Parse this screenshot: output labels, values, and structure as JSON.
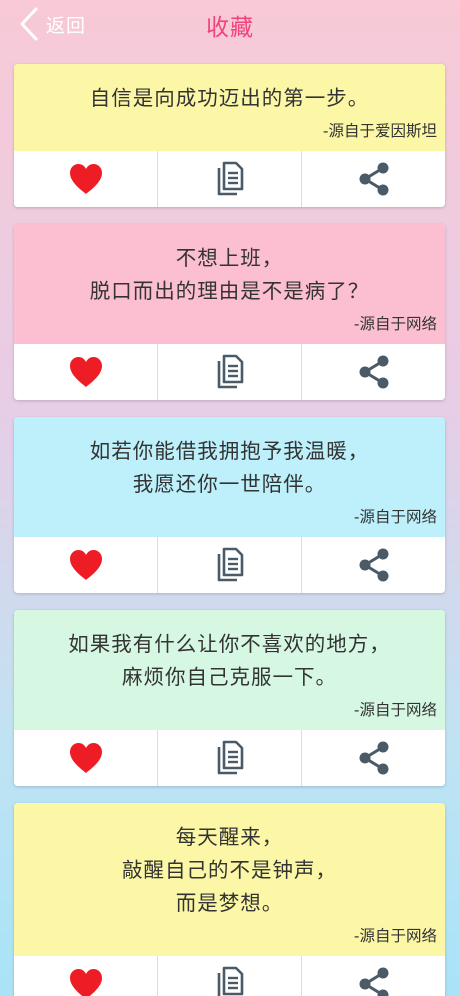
{
  "header": {
    "back_label": "返回",
    "title": "收藏"
  },
  "colors": {
    "title": "#f0437a",
    "heart": "#ee1c25",
    "icon_gray": "#4a5a67"
  },
  "cards": [
    {
      "quote": "自信是向成功迈出的第一步。",
      "source": "-源自于爱因斯坦",
      "bg": "#fbf7a6"
    },
    {
      "quote": "不想上班，\n脱口而出的理由是不是病了？",
      "source": "-源自于网络",
      "bg": "#fcbfd2"
    },
    {
      "quote": "如若你能借我拥抱予我温暖，\n我愿还你一世陪伴。",
      "source": "-源自于网络",
      "bg": "#bdf0fb"
    },
    {
      "quote": "如果我有什么让你不喜欢的地方，\n麻烦你自己克服一下。",
      "source": "-源自于网络",
      "bg": "#d6f8e3"
    },
    {
      "quote": "每天醒来，\n敲醒自己的不是钟声，\n而是梦想。",
      "source": "-源自于网络",
      "bg": "#fbf7a6"
    }
  ],
  "icons": {
    "favorite": "heart-icon",
    "copy": "copy-icon",
    "share": "share-icon"
  }
}
